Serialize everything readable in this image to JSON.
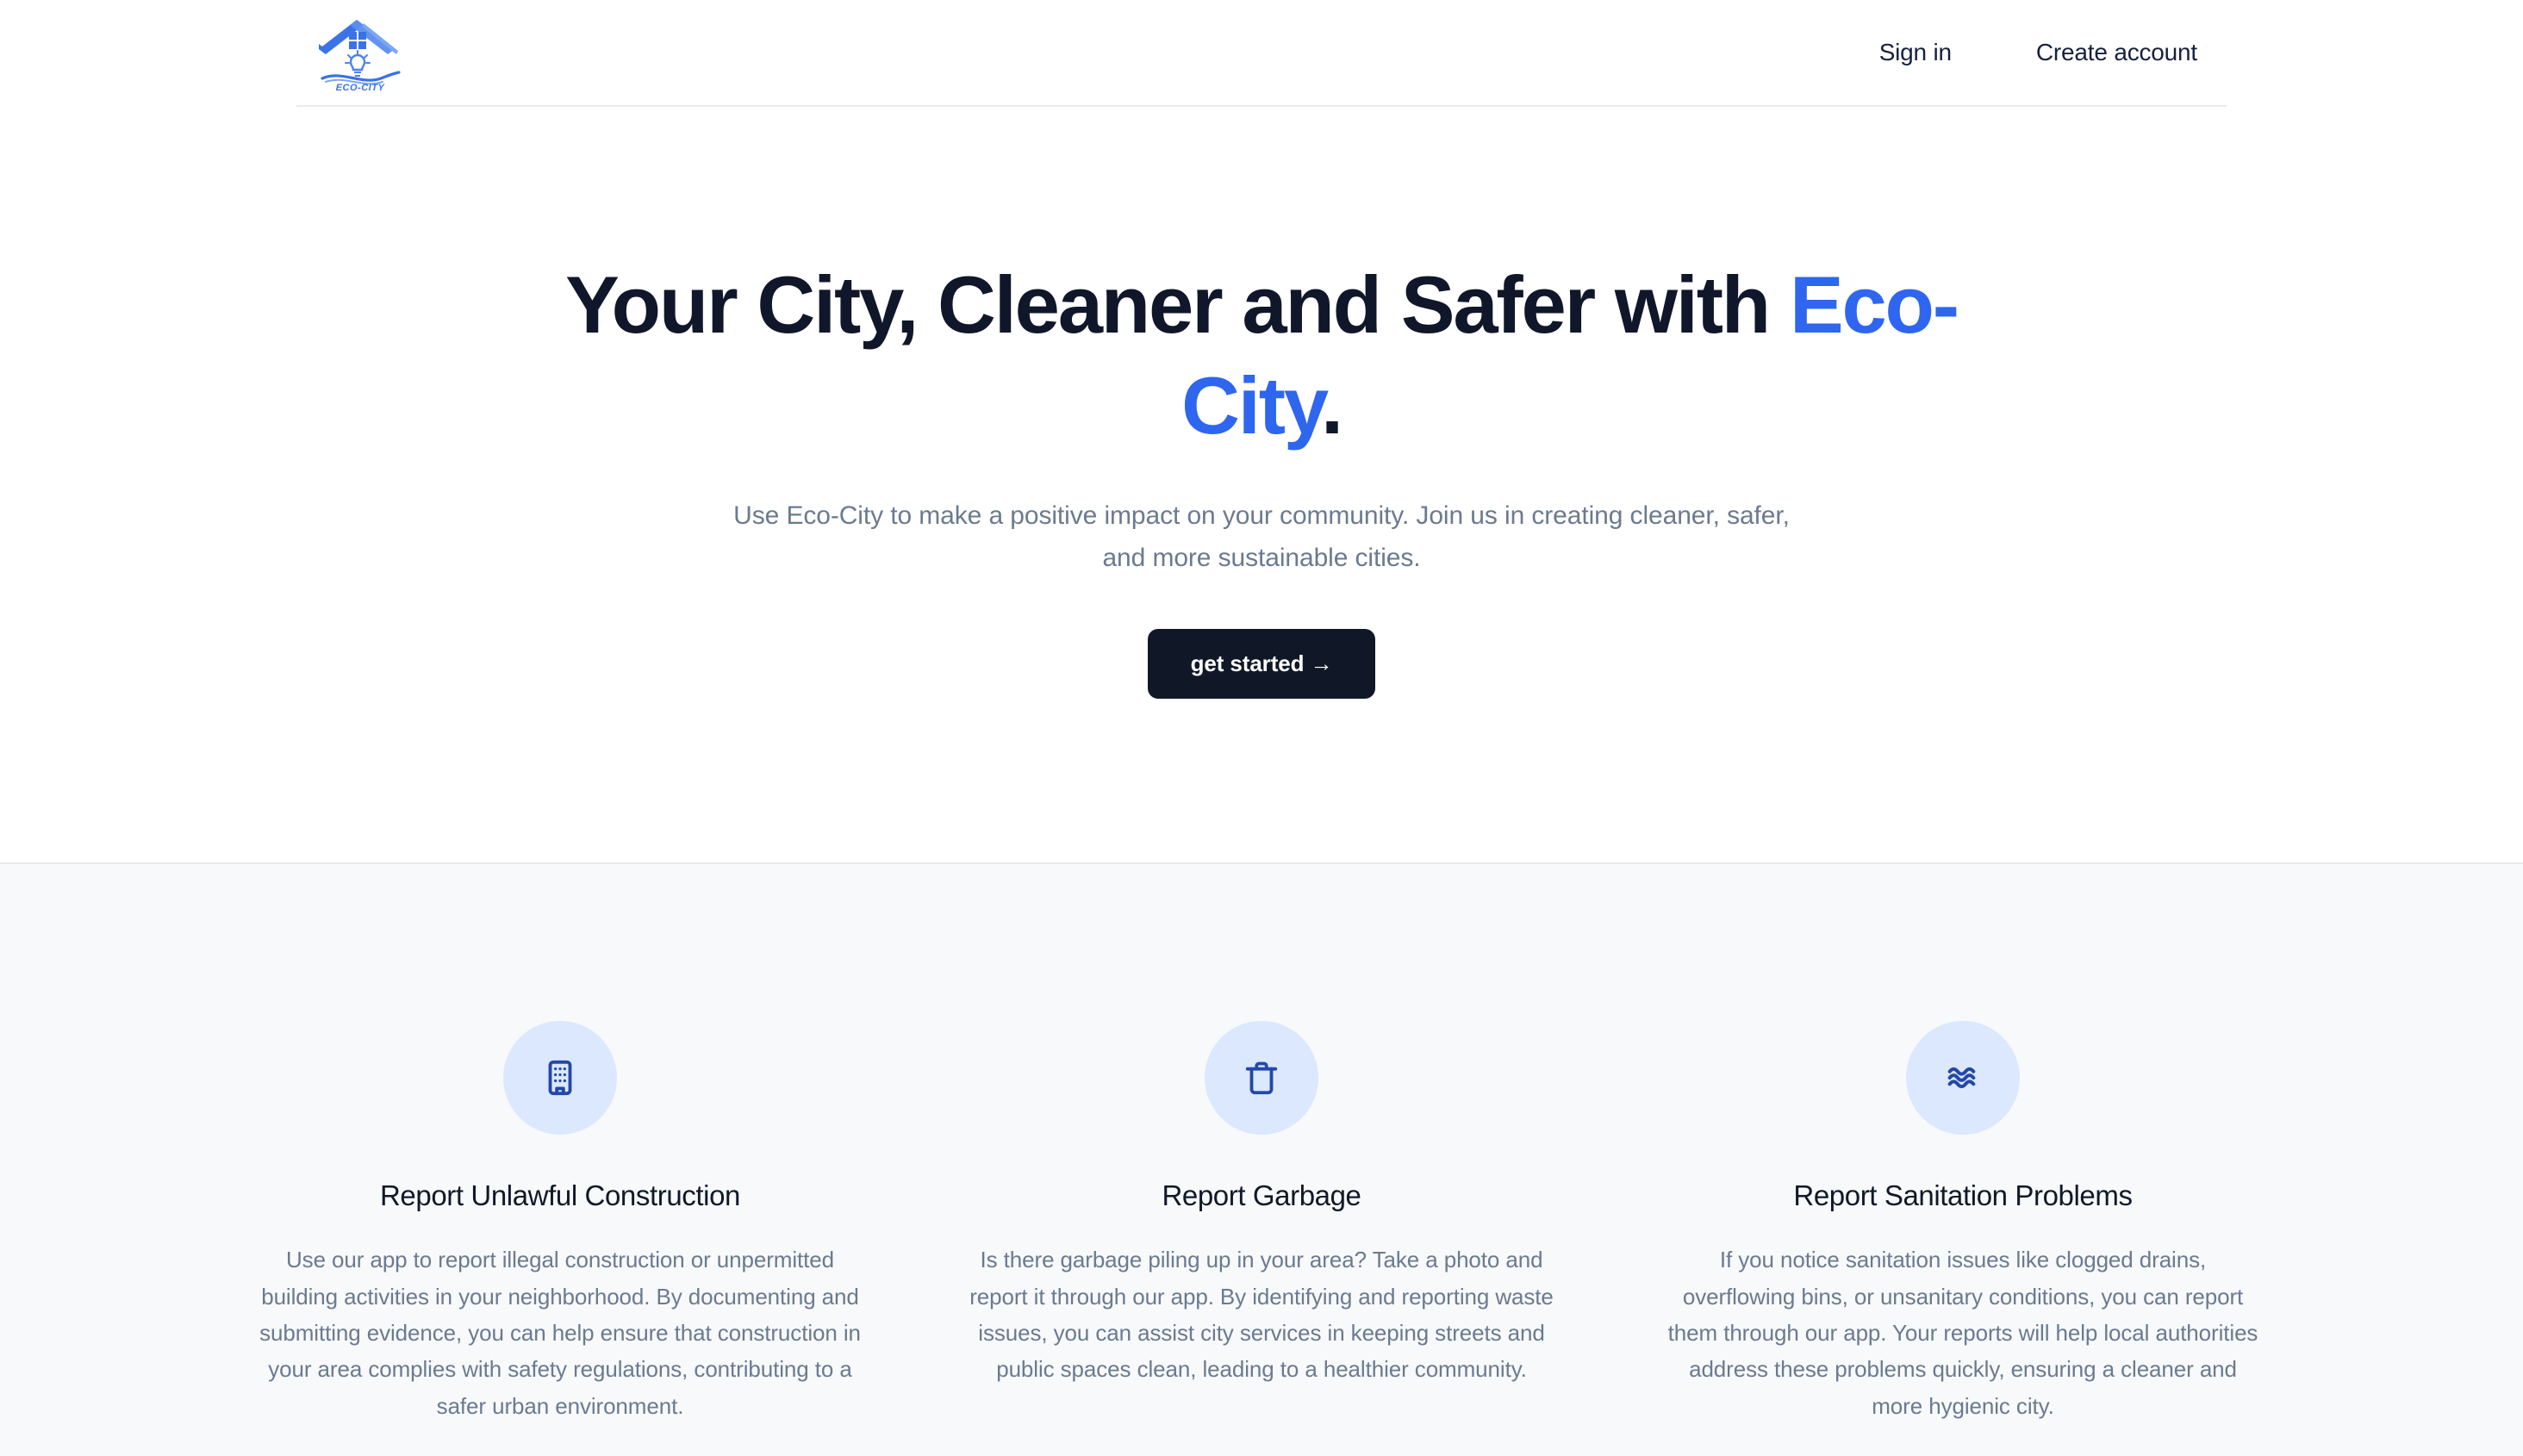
{
  "brand": {
    "name": "Eco-City",
    "logo_text": "ECO-CITY",
    "logo_icon": "house-bulb-wave-logo",
    "accent_color": "#2f66ef",
    "logo_color": "#3a72e8"
  },
  "header": {
    "nav": [
      {
        "label": "Sign in",
        "name": "sign-in-link"
      },
      {
        "label": "Create account",
        "name": "create-account-link"
      }
    ]
  },
  "hero": {
    "title_part1": "Your City, Cleaner and Safer with ",
    "title_accent": "Eco-City",
    "title_period": ".",
    "subtitle": "Use Eco-City to make a positive impact on your community. Join us in creating cleaner, safer, and more sustainable cities.",
    "cta_label": "get started →",
    "cta_bg": "#101828"
  },
  "features": {
    "items": [
      {
        "icon": "building-icon",
        "icon_bg": "#dbe8fd",
        "icon_color": "#2348a8",
        "title": "Report Unlawful Construction",
        "description": "Use our app to report illegal construction or unpermitted building activities in your neighborhood. By documenting and submitting evidence, you can help ensure that construction in your area complies with safety regulations, contributing to a safer urban environment."
      },
      {
        "icon": "trash-icon",
        "icon_bg": "#dbe8fd",
        "icon_color": "#2348a8",
        "title": "Report Garbage",
        "description": "Is there garbage piling up in your area? Take a photo and report it through our app. By identifying and reporting waste issues, you can assist city services in keeping streets and public spaces clean, leading to a healthier community."
      },
      {
        "icon": "waves-icon",
        "icon_bg": "#dbe8fd",
        "icon_color": "#2348a8",
        "title": "Report Sanitation Problems",
        "description": "If you notice sanitation issues like clogged drains, overflowing bins, or unsanitary conditions, you can report them through our app. Your reports will help local authorities address these problems quickly, ensuring a cleaner and more hygienic city."
      }
    ]
  }
}
